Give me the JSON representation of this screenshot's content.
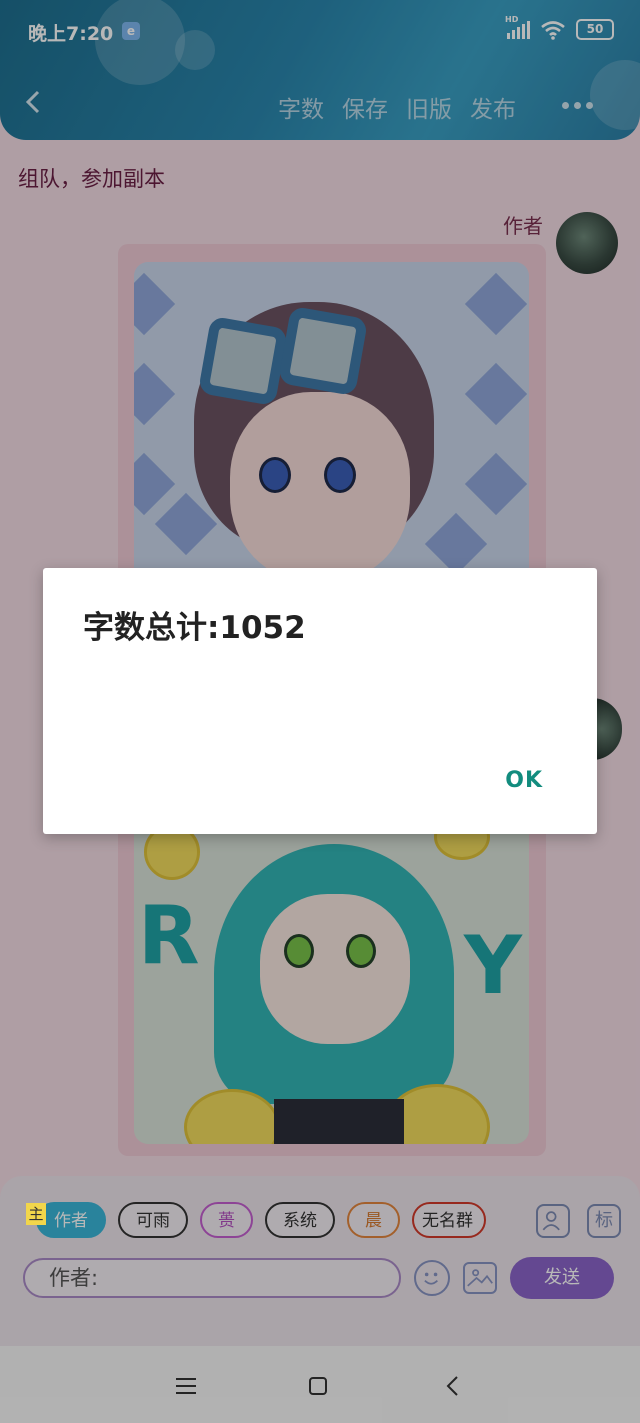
{
  "status_bar": {
    "time": "晚上7:20",
    "app_badge": "e",
    "network": "HD",
    "wifi_label": "6",
    "battery": "50"
  },
  "header": {
    "actions": [
      "字数",
      "保存",
      "旧版",
      "发布"
    ]
  },
  "chat": {
    "scene_title": "组队，参加副本",
    "author_name": "作者"
  },
  "dialog": {
    "message": "字数总计:1052",
    "ok_label": "OK"
  },
  "input_bar": {
    "main_tag": "主",
    "chips": [
      "作者",
      "可雨",
      "蒉",
      "系统",
      "晨",
      "无名群"
    ],
    "side_icon_label": "标",
    "input_value": "作者:",
    "send_label": "发送"
  },
  "colors": {
    "header": "#2a86ad",
    "send_button": "#8b65c9",
    "ok_text": "#128c7e",
    "active_chip": "#3ab6d9"
  },
  "icons": [
    "back-arrow-icon",
    "more-icon",
    "person-icon",
    "emoji-icon",
    "image-icon",
    "menu-icon",
    "home-icon",
    "back-icon"
  ]
}
